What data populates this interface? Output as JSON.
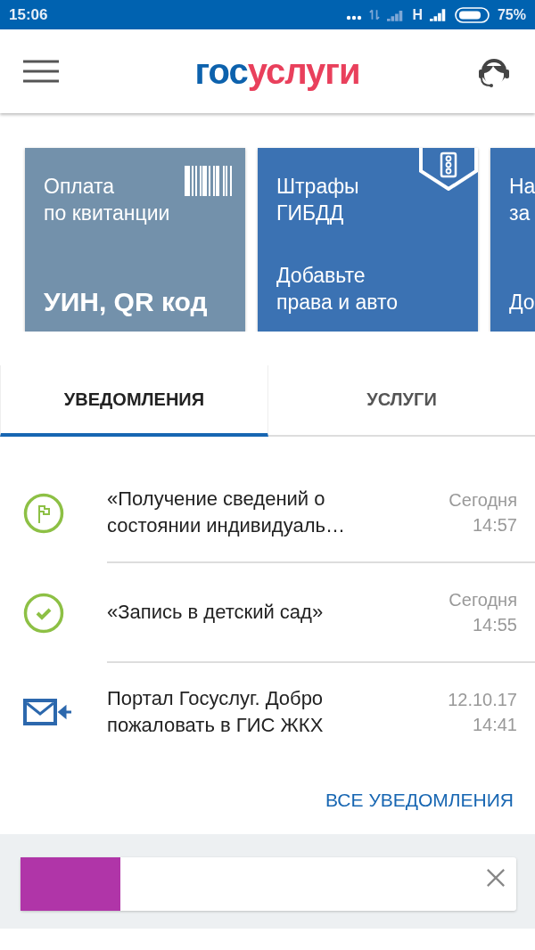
{
  "status_bar": {
    "time": "15:06",
    "network": "H",
    "battery": "75%"
  },
  "header": {
    "logo": {
      "part_1": "гос",
      "part_2": "услуги"
    }
  },
  "cards": [
    {
      "kind": "barcode",
      "title": [
        "Оплата",
        "по квитанции"
      ],
      "subtitle": [
        "УИН, QR код"
      ],
      "color": "#7391ab"
    },
    {
      "kind": "traffic",
      "title": [
        "Штрафы",
        "ГИБДД"
      ],
      "subtitle": [
        "Добавьте",
        "права и авто"
      ],
      "color": "#3b72b3"
    },
    {
      "kind": "plain",
      "title": [
        "На",
        "за"
      ],
      "subtitle": [
        "До"
      ],
      "color": "#3b72b3"
    }
  ],
  "tabs": [
    {
      "label": "УВЕДОМЛЕНИЯ",
      "selected": true
    },
    {
      "label": "УСЛУГИ",
      "selected": false
    }
  ],
  "notifications": [
    {
      "kind": "flag",
      "text": "«Получение сведений о состоянии индивидуаль…",
      "date": "Сегодня",
      "time": "14:57"
    },
    {
      "kind": "check",
      "text": "«Запись в детский сад»",
      "date": "Сегодня",
      "time": "14:55"
    },
    {
      "kind": "mail",
      "text": "Портал Госуслуг. Добро пожаловать в ГИС ЖКХ",
      "date": "12.10.17",
      "time": "14:41"
    }
  ],
  "all_link": "ВСЕ УВЕДОМЛЕНИЯ",
  "promo": {
    "color": "#b035a8"
  }
}
